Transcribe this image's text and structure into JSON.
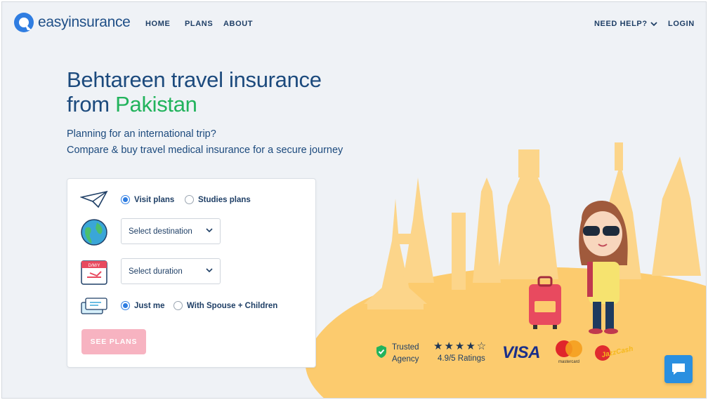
{
  "brand": {
    "logo_text_bold": "easy",
    "logo_text_rest": "insurance"
  },
  "nav": {
    "home": "HOME",
    "plans": "PLANS",
    "about": "ABOUT",
    "help": "NEED HELP?",
    "login": "LOGIN"
  },
  "hero": {
    "headline_line1": "Behtareen travel insurance",
    "headline_line2_prefix": "from ",
    "headline_line2_accent": "Pakistan",
    "subtitle_line1": "Planning for an international trip?",
    "subtitle_line2": "Compare & buy travel medical insurance for a secure journey"
  },
  "form": {
    "plan_type": {
      "options": [
        "Visit plans",
        "Studies plans"
      ],
      "selected": "Visit plans"
    },
    "destination": {
      "placeholder": "Select destination"
    },
    "duration": {
      "placeholder": "Select duration"
    },
    "travellers": {
      "options": [
        "Just me",
        "With Spouse + Children"
      ],
      "selected": "Just me"
    },
    "submit_label": "SEE PLANS",
    "calendar_label": "D/M/Y"
  },
  "trust": {
    "trusted_line1": "Trusted",
    "trusted_line2": "Agency",
    "stars": "★★★★☆",
    "rating": "4.9/5 Ratings",
    "payment_visa": "VISA",
    "payment_mastercard": "mastercard",
    "payment_jazzcash": "JazzCash"
  },
  "colors": {
    "primary_blue": "#1c4a7d",
    "accent_green": "#22b35c",
    "button_pink": "#f7b3c1",
    "radio_blue": "#2f7de1",
    "illustration_yellow": "#fccb6e",
    "chat_blue": "#2a8fe0"
  },
  "icons": [
    "logo-icon",
    "chevron-down-icon",
    "paper-plane-icon",
    "globe-icon",
    "calendar-icon",
    "tickets-icon",
    "shield-check-icon",
    "chat-icon"
  ]
}
